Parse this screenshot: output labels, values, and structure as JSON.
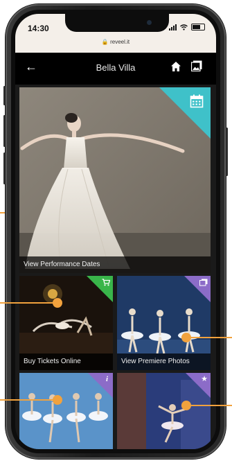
{
  "status": {
    "time": "14:30",
    "url": "reveel.it"
  },
  "nav": {
    "title": "Bella Villa"
  },
  "tiles": {
    "performance": {
      "caption": "View Performance Dates",
      "badge_icon": "calendar-icon"
    },
    "tickets": {
      "caption": "Buy Tickets Online",
      "badge_icon": "cart-icon"
    },
    "premiere": {
      "caption": "View Premiere Photos",
      "badge_icon": "photos-icon"
    },
    "info": {
      "badge_icon": "info-icon",
      "badge_text": "i"
    },
    "favorite": {
      "badge_icon": "star-icon",
      "badge_text": "★"
    }
  },
  "colors": {
    "teal": "#3fc1c9",
    "green": "#39b54a",
    "purple": "#8c6cc8",
    "callout": "#f2a23d"
  }
}
